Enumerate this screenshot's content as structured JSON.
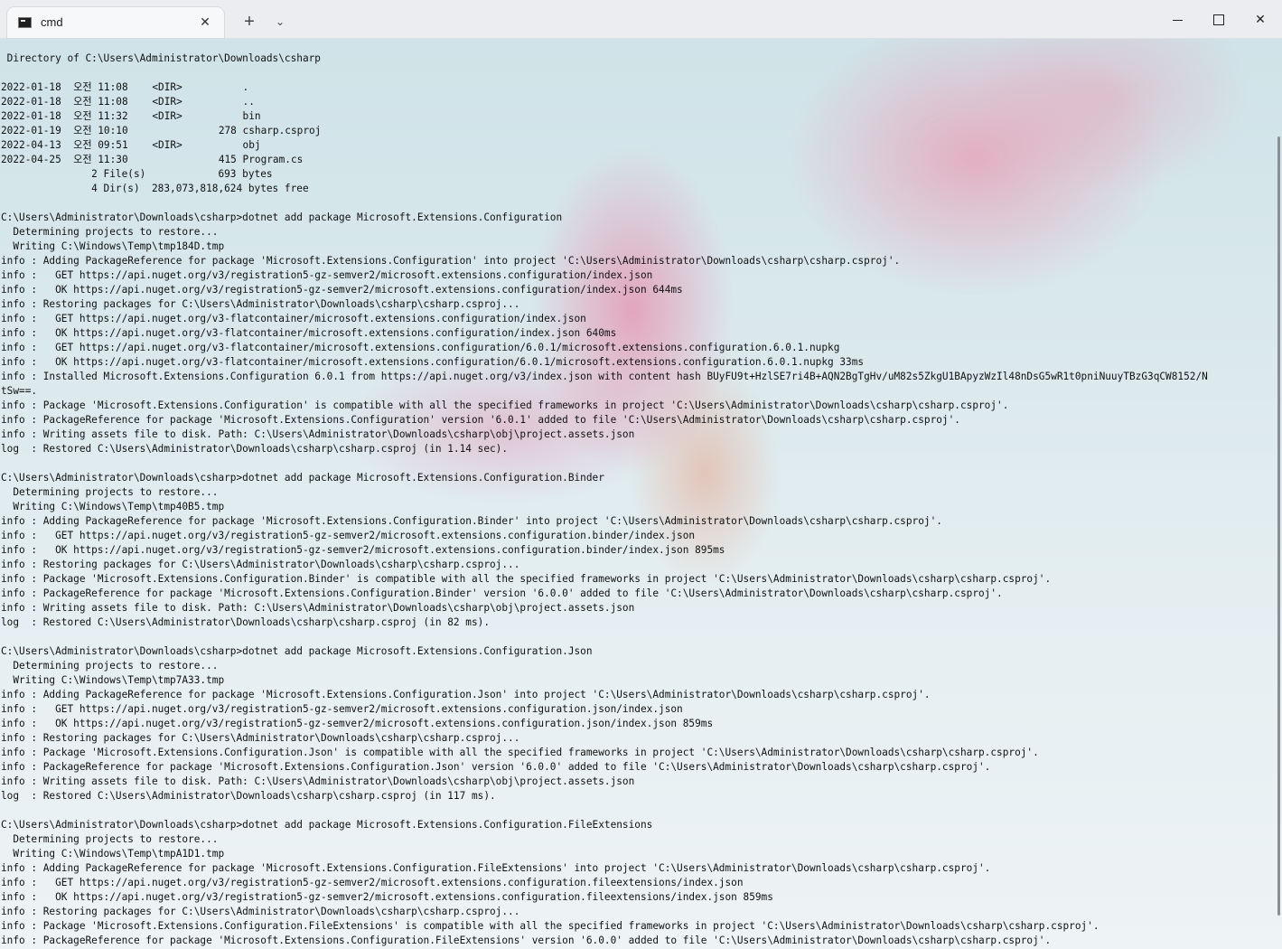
{
  "window": {
    "tab_title": "cmd",
    "tab_close": "✕",
    "new_tab": "+",
    "dropdown": "⌄",
    "close": "✕"
  },
  "terminal": {
    "lines": [
      " Directory of C:\\Users\\Administrator\\Downloads\\csharp",
      "",
      "2022-01-18  오전 11:08    <DIR>          .",
      "2022-01-18  오전 11:08    <DIR>          ..",
      "2022-01-18  오전 11:32    <DIR>          bin",
      "2022-01-19  오전 10:10               278 csharp.csproj",
      "2022-04-13  오전 09:51    <DIR>          obj",
      "2022-04-25  오전 11:30               415 Program.cs",
      "               2 File(s)            693 bytes",
      "               4 Dir(s)  283,073,818,624 bytes free",
      "",
      "C:\\Users\\Administrator\\Downloads\\csharp>dotnet add package Microsoft.Extensions.Configuration",
      "  Determining projects to restore...",
      "  Writing C:\\Windows\\Temp\\tmp184D.tmp",
      "info : Adding PackageReference for package 'Microsoft.Extensions.Configuration' into project 'C:\\Users\\Administrator\\Downloads\\csharp\\csharp.csproj'.",
      "info :   GET https://api.nuget.org/v3/registration5-gz-semver2/microsoft.extensions.configuration/index.json",
      "info :   OK https://api.nuget.org/v3/registration5-gz-semver2/microsoft.extensions.configuration/index.json 644ms",
      "info : Restoring packages for C:\\Users\\Administrator\\Downloads\\csharp\\csharp.csproj...",
      "info :   GET https://api.nuget.org/v3-flatcontainer/microsoft.extensions.configuration/index.json",
      "info :   OK https://api.nuget.org/v3-flatcontainer/microsoft.extensions.configuration/index.json 640ms",
      "info :   GET https://api.nuget.org/v3-flatcontainer/microsoft.extensions.configuration/6.0.1/microsoft.extensions.configuration.6.0.1.nupkg",
      "info :   OK https://api.nuget.org/v3-flatcontainer/microsoft.extensions.configuration/6.0.1/microsoft.extensions.configuration.6.0.1.nupkg 33ms",
      "info : Installed Microsoft.Extensions.Configuration 6.0.1 from https://api.nuget.org/v3/index.json with content hash BUyFU9t+HzlSE7ri4B+AQN2BgTgHv/uM82s5ZkgU1BApyzWzIl48nDsG5wR1t0pniNuuyTBzG3qCW8152/N",
      "tSw==.",
      "info : Package 'Microsoft.Extensions.Configuration' is compatible with all the specified frameworks in project 'C:\\Users\\Administrator\\Downloads\\csharp\\csharp.csproj'.",
      "info : PackageReference for package 'Microsoft.Extensions.Configuration' version '6.0.1' added to file 'C:\\Users\\Administrator\\Downloads\\csharp\\csharp.csproj'.",
      "info : Writing assets file to disk. Path: C:\\Users\\Administrator\\Downloads\\csharp\\obj\\project.assets.json",
      "log  : Restored C:\\Users\\Administrator\\Downloads\\csharp\\csharp.csproj (in 1.14 sec).",
      "",
      "C:\\Users\\Administrator\\Downloads\\csharp>dotnet add package Microsoft.Extensions.Configuration.Binder",
      "  Determining projects to restore...",
      "  Writing C:\\Windows\\Temp\\tmp40B5.tmp",
      "info : Adding PackageReference for package 'Microsoft.Extensions.Configuration.Binder' into project 'C:\\Users\\Administrator\\Downloads\\csharp\\csharp.csproj'.",
      "info :   GET https://api.nuget.org/v3/registration5-gz-semver2/microsoft.extensions.configuration.binder/index.json",
      "info :   OK https://api.nuget.org/v3/registration5-gz-semver2/microsoft.extensions.configuration.binder/index.json 895ms",
      "info : Restoring packages for C:\\Users\\Administrator\\Downloads\\csharp\\csharp.csproj...",
      "info : Package 'Microsoft.Extensions.Configuration.Binder' is compatible with all the specified frameworks in project 'C:\\Users\\Administrator\\Downloads\\csharp\\csharp.csproj'.",
      "info : PackageReference for package 'Microsoft.Extensions.Configuration.Binder' version '6.0.0' added to file 'C:\\Users\\Administrator\\Downloads\\csharp\\csharp.csproj'.",
      "info : Writing assets file to disk. Path: C:\\Users\\Administrator\\Downloads\\csharp\\obj\\project.assets.json",
      "log  : Restored C:\\Users\\Administrator\\Downloads\\csharp\\csharp.csproj (in 82 ms).",
      "",
      "C:\\Users\\Administrator\\Downloads\\csharp>dotnet add package Microsoft.Extensions.Configuration.Json",
      "  Determining projects to restore...",
      "  Writing C:\\Windows\\Temp\\tmp7A33.tmp",
      "info : Adding PackageReference for package 'Microsoft.Extensions.Configuration.Json' into project 'C:\\Users\\Administrator\\Downloads\\csharp\\csharp.csproj'.",
      "info :   GET https://api.nuget.org/v3/registration5-gz-semver2/microsoft.extensions.configuration.json/index.json",
      "info :   OK https://api.nuget.org/v3/registration5-gz-semver2/microsoft.extensions.configuration.json/index.json 859ms",
      "info : Restoring packages for C:\\Users\\Administrator\\Downloads\\csharp\\csharp.csproj...",
      "info : Package 'Microsoft.Extensions.Configuration.Json' is compatible with all the specified frameworks in project 'C:\\Users\\Administrator\\Downloads\\csharp\\csharp.csproj'.",
      "info : PackageReference for package 'Microsoft.Extensions.Configuration.Json' version '6.0.0' added to file 'C:\\Users\\Administrator\\Downloads\\csharp\\csharp.csproj'.",
      "info : Writing assets file to disk. Path: C:\\Users\\Administrator\\Downloads\\csharp\\obj\\project.assets.json",
      "log  : Restored C:\\Users\\Administrator\\Downloads\\csharp\\csharp.csproj (in 117 ms).",
      "",
      "C:\\Users\\Administrator\\Downloads\\csharp>dotnet add package Microsoft.Extensions.Configuration.FileExtensions",
      "  Determining projects to restore...",
      "  Writing C:\\Windows\\Temp\\tmpA1D1.tmp",
      "info : Adding PackageReference for package 'Microsoft.Extensions.Configuration.FileExtensions' into project 'C:\\Users\\Administrator\\Downloads\\csharp\\csharp.csproj'.",
      "info :   GET https://api.nuget.org/v3/registration5-gz-semver2/microsoft.extensions.configuration.fileextensions/index.json",
      "info :   OK https://api.nuget.org/v3/registration5-gz-semver2/microsoft.extensions.configuration.fileextensions/index.json 859ms",
      "info : Restoring packages for C:\\Users\\Administrator\\Downloads\\csharp\\csharp.csproj...",
      "info : Package 'Microsoft.Extensions.Configuration.FileExtensions' is compatible with all the specified frameworks in project 'C:\\Users\\Administrator\\Downloads\\csharp\\csharp.csproj'.",
      "info : PackageReference for package 'Microsoft.Extensions.Configuration.FileExtensions' version '6.0.0' added to file 'C:\\Users\\Administrator\\Downloads\\csharp\\csharp.csproj'."
    ]
  }
}
